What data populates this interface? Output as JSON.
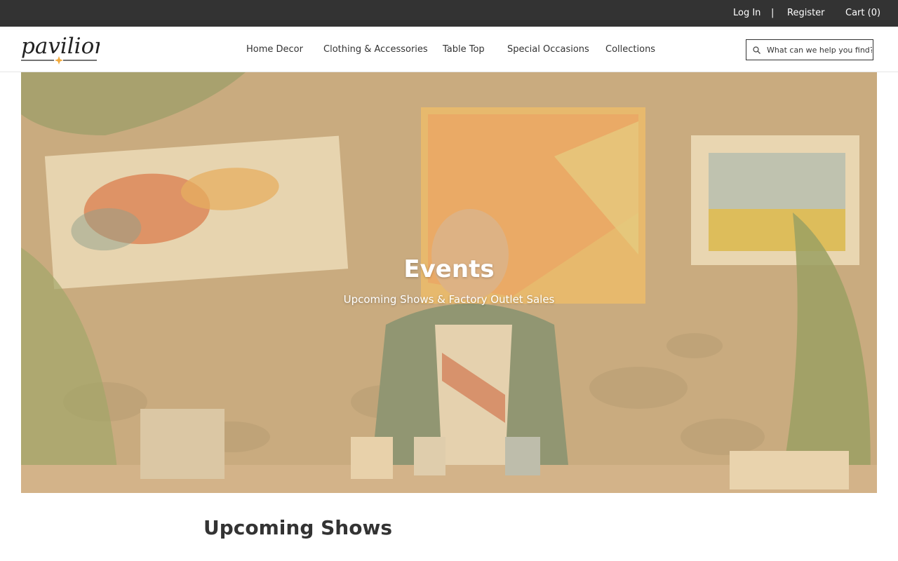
{
  "topbar": {
    "login_label": "Log In",
    "separator": "|",
    "register_label": "Register",
    "cart_label": "Cart (0)"
  },
  "brand": {
    "logo_text": "pavilion",
    "logo_accent_color": "#f2a93b"
  },
  "nav": {
    "items": [
      {
        "label": "Home Decor"
      },
      {
        "label": "Clothing & Accessories"
      },
      {
        "label": "Table Top"
      },
      {
        "label": "Special Occasions"
      },
      {
        "label": "Collections"
      }
    ]
  },
  "search": {
    "placeholder": "What can we help you find?",
    "value": "",
    "icon": "search-icon"
  },
  "hero": {
    "title": "Events",
    "subtitle": "Upcoming Shows & Factory Outlet Sales",
    "overlay_color": "#e6c48c"
  },
  "main": {
    "section_title": "Upcoming Shows"
  },
  "colors": {
    "topbar_bg": "#333333",
    "text": "#333333"
  }
}
